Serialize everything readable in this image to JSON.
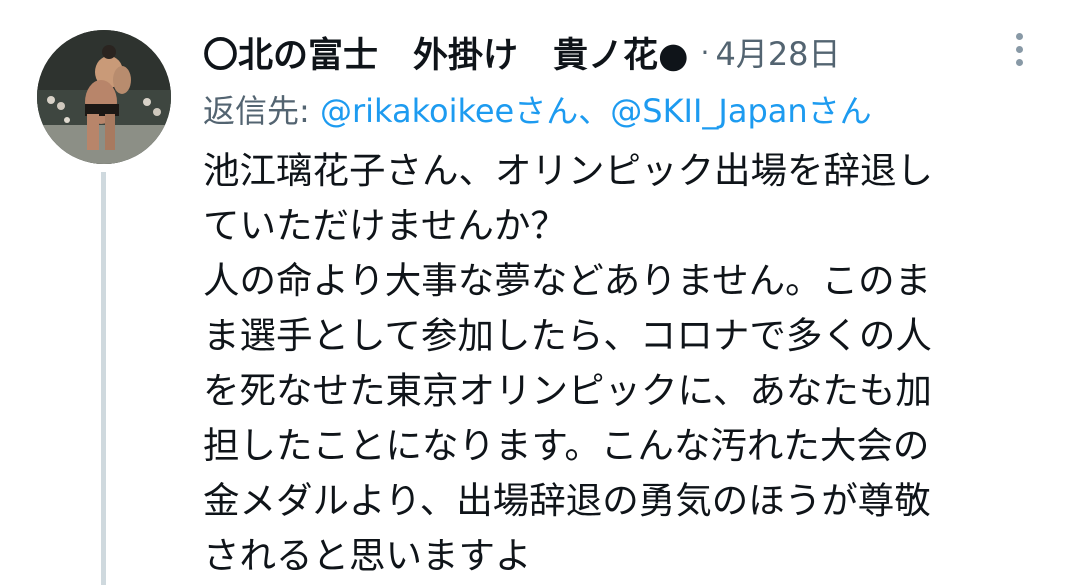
{
  "tweet": {
    "display_name": "〇北の富士　外掛け　貴ノ花●",
    "separator": "·",
    "date": "4月28日",
    "reply_prefix": "返信先: ",
    "reply_handle_1": "@rikakoikeeさん",
    "reply_join": "、",
    "reply_handle_2": "@SKII_Japanさん",
    "text_lines": [
      "池江璃花子さん、オリンピック出場を辞退し",
      "ていただけませんか？",
      "人の命より大事な夢などありません。このま",
      "ま選手として参加したら、コロナで多くの人",
      "を死なせた東京オリンピックに、あなたも加",
      "担したことになります。こんな汚れた大会の",
      "金メダルより、出場辞退の勇気のほうが尊敬",
      "されると思いますよ"
    ]
  },
  "icons": {
    "avatar": "sumo-wrestler-avatar",
    "more": "more-vertical-icon"
  },
  "colors": {
    "handle": "#1d9bf0",
    "muted": "#536471",
    "text": "#0f1419",
    "thread": "#cfd9de"
  }
}
